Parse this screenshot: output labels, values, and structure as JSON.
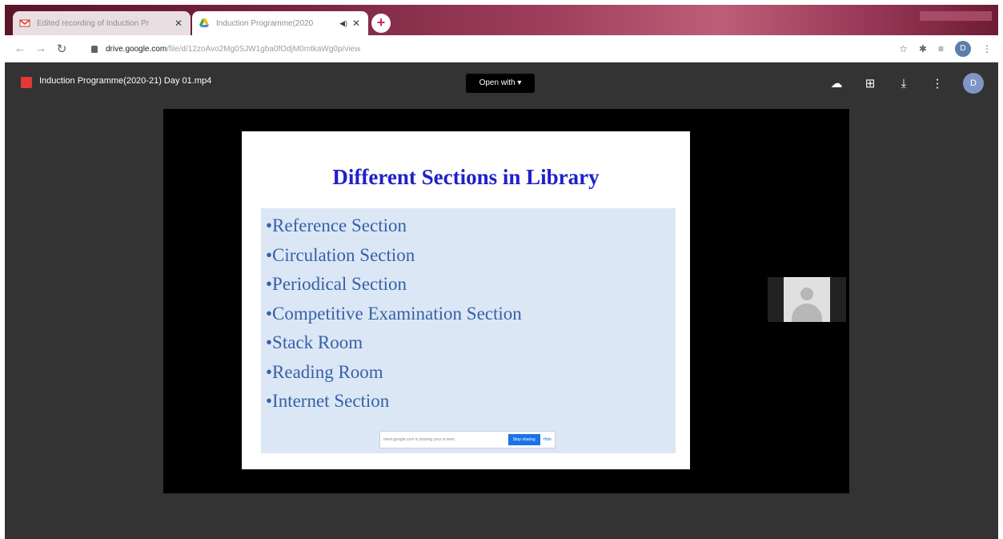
{
  "browser": {
    "tabs": [
      {
        "title": "Edited recording of Induction Pr",
        "favicon": "gmail-icon",
        "active": false
      },
      {
        "title": "Induction Programme(2020",
        "favicon": "google-drive-icon",
        "active": true
      }
    ],
    "address": {
      "host": "drive.google.com",
      "path": "/file/d/12zoAvo2Mg0SJW1gba0fOdjM0mtkaWg0p/view"
    }
  },
  "viewer": {
    "file_title": "Induction Programme(2020-21) Day 01.mp4",
    "open_with_label": "Open with",
    "profile_initial": "D"
  },
  "slide": {
    "title": "Different Sections in Library",
    "bullets": [
      "•Reference Section",
      "•Circulation Section",
      "•Periodical Section",
      "•Competitive Examination Section",
      "•Stack Room",
      "•Reading Room",
      "•Internet Section"
    ],
    "share_bar": {
      "text": "meet.google.com is sharing your screen.",
      "stop_label": "Stop sharing",
      "hide_label": "Hide"
    }
  },
  "colors": {
    "tab_strip": "#7a2540",
    "viewer_bg": "#333333",
    "slide_title": "#2020c8",
    "slide_bullets": "#3561a8",
    "slide_panel": "#dce7f5"
  }
}
